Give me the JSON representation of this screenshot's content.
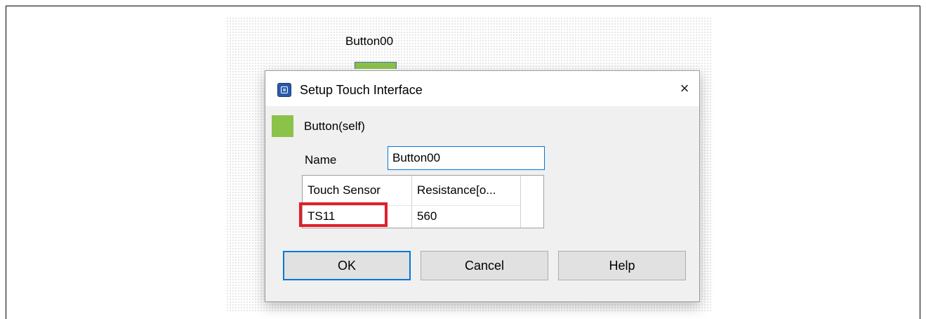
{
  "canvas": {
    "widget_label": "Button00",
    "widget_color": "#8bc34a"
  },
  "dialog": {
    "title": "Setup Touch Interface",
    "app_icon": "renesas-app-icon",
    "close_icon": "×",
    "selected_item": {
      "label": "Button(self)",
      "color": "#8bc34a"
    },
    "name": {
      "label": "Name",
      "value": "Button00"
    },
    "table": {
      "columns": [
        "Touch Sensor",
        "Resistance[o..."
      ],
      "rows": [
        [
          "TS11",
          "560"
        ]
      ]
    },
    "buttons": {
      "ok": "OK",
      "cancel": "Cancel",
      "help": "Help"
    },
    "accent_color": "#0078d7",
    "highlight_color": "#e0202a"
  }
}
